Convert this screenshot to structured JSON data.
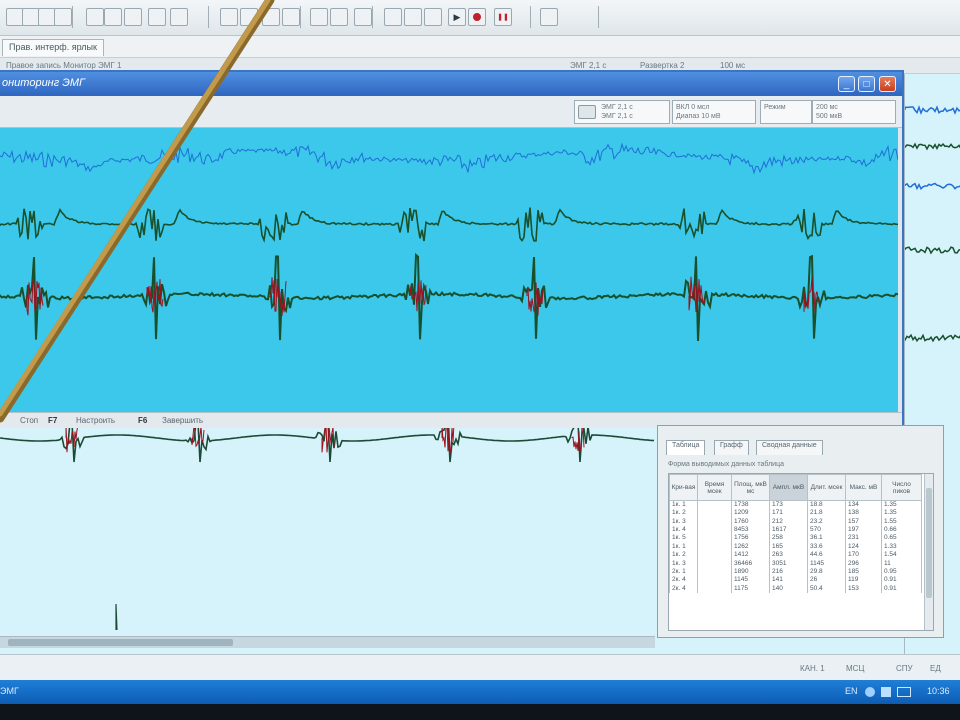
{
  "app": {
    "menu_tab_label": "Прав. интерф. ярлык",
    "status_left": "Правое запись Монитор ЭМГ 1",
    "status_mid_1": "ЭМГ 2,1 с",
    "status_mid_2": "Развертка 2",
    "status_right": "100 мс"
  },
  "toolbar": {
    "icons": [
      "new-icon",
      "open-icon",
      "copy-icon",
      "paste-icon",
      "cut-icon",
      "print-icon",
      "back-icon",
      "forward-icon",
      "save-icon",
      "stats-icon",
      "chart-icon",
      "monitor-icon",
      "lock-icon",
      "grid-icon",
      "window-icon",
      "tile-icon",
      "filter-icon",
      "sync-icon",
      "arrow-icon",
      "play-icon",
      "record-icon",
      "pause-icon",
      "blank-icon"
    ]
  },
  "monitor": {
    "title": "ониторинг ЭМГ",
    "ctrl_1_line1": "ЭМГ 2,1 с",
    "ctrl_1_line2": "ЭМГ 2,1 с",
    "ctrl_2_line1": "ВКЛ 0 мсл",
    "ctrl_2_line2": "Диапаз 10 мВ",
    "ctrl_3_line1": "Режим",
    "ctrl_4_line1": "200 мс",
    "ctrl_4_line2": "500 мкВ",
    "status_1": "Стоп",
    "status_key_1": "F7",
    "status_2": "Настроить",
    "status_key_2": "F6",
    "status_3": "Завершить",
    "minimize": "_",
    "maximize": "□",
    "close": "✕"
  },
  "stats": {
    "tabs": [
      "Таблица",
      "Графф",
      "Сводная данные"
    ],
    "caption": "Форма выводимых данных таблица",
    "headers": [
      "Кри-вая",
      "Время мсек",
      "Площ. мкВ мс",
      "Ампл. мкВ",
      "Длит. мсек",
      "Макс. мВ",
      "Число пиков"
    ],
    "rows": [
      [
        "1к. 1",
        "",
        "1738",
        "173",
        "18.8",
        "134",
        "1.35"
      ],
      [
        "1к. 2",
        "",
        "1209",
        "171",
        "21.8",
        "138",
        "1.35"
      ],
      [
        "1к. 3",
        "",
        "1760",
        "212",
        "23.2",
        "157",
        "1.55"
      ],
      [
        "1к. 4",
        "",
        "8453",
        "1617",
        "570",
        "197",
        "0.66"
      ],
      [
        "1к. 5",
        "",
        "1756",
        "258",
        "36.1",
        "231",
        "0.65"
      ],
      [
        "1к. 1",
        "",
        "1262",
        "165",
        "33.6",
        "124",
        "1.33"
      ],
      [
        "1к. 2",
        "",
        "1412",
        "263",
        "44.6",
        "170",
        "1.54"
      ],
      [
        "1к. 3",
        "",
        "36466",
        "3051",
        "1145",
        "296",
        "11"
      ],
      [
        "2к. 1",
        "",
        "1890",
        "216",
        "29.8",
        "185",
        "0.95"
      ],
      [
        "2к. 4",
        "",
        "1145",
        "141",
        "26",
        "119",
        "0.91"
      ],
      [
        "2к. 4",
        "",
        "1175",
        "140",
        "50.4",
        "153",
        "0.91"
      ]
    ]
  },
  "bottom": {
    "status_1": "КАН. 1",
    "status_2": "МСЦ",
    "status_3": "СПУ",
    "status_4": "ЕД"
  },
  "taskbar": {
    "label": "ЭМГ",
    "lang": "EN",
    "time": "10:36"
  },
  "colors": {
    "plot_bg": "#3cc8ea",
    "trace_blue": "#1f6fd6",
    "trace_green": "#18502b",
    "spike_red": "#a0101c",
    "title_bar": "#2f66c0",
    "pointer": "#b58a3d"
  }
}
